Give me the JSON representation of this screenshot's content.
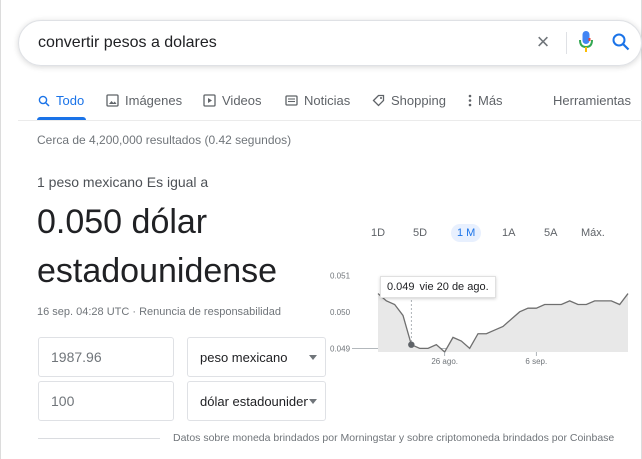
{
  "search": {
    "query": "convertir pesos a dolares",
    "clear_icon": "close-icon",
    "mic_icon": "mic-icon",
    "search_icon": "search-icon"
  },
  "tabs": [
    {
      "label": "Todo",
      "icon": "search-icon",
      "active": true
    },
    {
      "label": "Imágenes",
      "icon": "image-icon",
      "active": false
    },
    {
      "label": "Videos",
      "icon": "video-icon",
      "active": false
    },
    {
      "label": "Noticias",
      "icon": "news-icon",
      "active": false
    },
    {
      "label": "Shopping",
      "icon": "tag-icon",
      "active": false
    },
    {
      "label": "Más",
      "icon": "more-vert-icon",
      "active": false
    }
  ],
  "tools_label": "Herramientas",
  "result_stats": "Cerca de 4,200,000 resultados (0.42 segundos)",
  "converter": {
    "equals_label": "1 peso mexicano Es igual a",
    "converted_value_line1": "0.050 dólar",
    "converted_value_line2": "estadounidense",
    "timestamp": "16 sep. 04:28 UTC · Renuncia de responsabilidad",
    "from_amount": "1987.96",
    "from_currency": "peso mexicano",
    "to_amount": "100",
    "to_currency": "dólar estadounidense"
  },
  "ranges": [
    {
      "label": "1D",
      "active": false
    },
    {
      "label": "5D",
      "active": false
    },
    {
      "label": "1 M",
      "active": true
    },
    {
      "label": "1A",
      "active": false
    },
    {
      "label": "5A",
      "active": false
    },
    {
      "label": "Máx.",
      "active": false
    }
  ],
  "tooltip": {
    "value": "0.049",
    "date": "vie 20 de ago."
  },
  "colors": {
    "accent": "#1a73e8",
    "line": "#6f6f6f",
    "fill": "#e8e8e8"
  },
  "chart_data": {
    "type": "area",
    "y_ticks": [
      "0.051",
      "0.050",
      "0.049"
    ],
    "ylim": [
      0.0489,
      0.0512
    ],
    "x_tick_labels": [
      "26 ago.",
      "6 sep."
    ],
    "x_tick_index": [
      8,
      19
    ],
    "series": [
      {
        "values": [
          0.0505,
          0.0503,
          0.0502,
          0.0499,
          0.0491,
          0.049,
          0.049,
          0.0491,
          0.0489,
          0.0493,
          0.0492,
          0.049,
          0.0494,
          0.0494,
          0.0495,
          0.0496,
          0.0498,
          0.05,
          0.0501,
          0.0501,
          0.0502,
          0.0502,
          0.0502,
          0.0503,
          0.0502,
          0.0502,
          0.0503,
          0.0503,
          0.0503,
          0.0502,
          0.0505
        ]
      }
    ],
    "highlight_index": 4
  },
  "footer": {
    "data_note": "Datos sobre moneda brindados por Morningstar y sobre criptomoneda brindados por Coinbase"
  }
}
